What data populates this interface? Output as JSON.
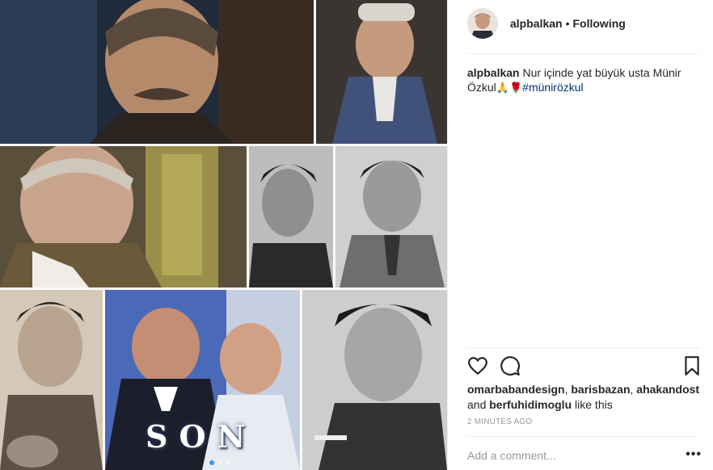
{
  "post": {
    "username": "alpbalkan",
    "separator": "•",
    "follow_status": "Following",
    "caption": {
      "username": "alpbalkan",
      "text": "Nur içinde yat büyük usta Münir Özkul",
      "emojis": [
        "🙏",
        "🌹"
      ],
      "hashtag": "#münirözkul"
    },
    "liked_by": [
      "omarbabandesign",
      "barisbazan",
      "ahakandost",
      "berfuhidimoglu"
    ],
    "likes_separator": ", ",
    "likes_and": "and",
    "likes_suffix": "like this",
    "timestamp": "2 MINUTES AGO",
    "comment_placeholder": "Add a comment...",
    "more_label": "•••",
    "overlay_text": "SON",
    "carousel": {
      "slides": 3,
      "active": 0
    },
    "icons": [
      "heart-icon",
      "comment-icon",
      "bookmark-icon",
      "more-icon"
    ]
  }
}
